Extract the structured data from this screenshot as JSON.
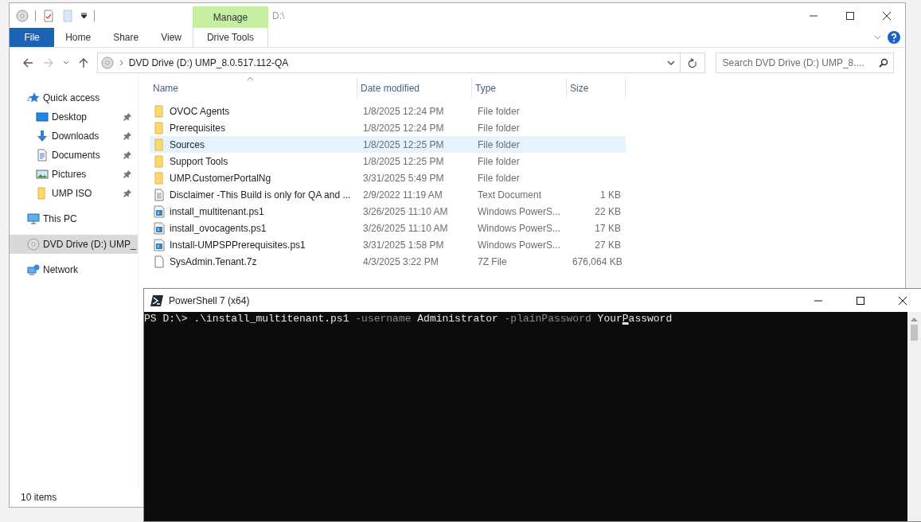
{
  "explorer": {
    "title": "D:\\",
    "contextual_header": "Manage",
    "ribbon_tabs": [
      {
        "label": "File",
        "kind": "file"
      },
      {
        "label": "Home",
        "kind": "tab"
      },
      {
        "label": "Share",
        "kind": "tab"
      },
      {
        "label": "View",
        "kind": "tab"
      },
      {
        "label": "Drive Tools",
        "kind": "contextual"
      }
    ],
    "address": {
      "path": "DVD Drive (D:) UMP_8.0.517.112-QA"
    },
    "search": {
      "placeholder": "Search DVD Drive (D:) UMP_8...."
    },
    "nav": [
      {
        "label": "Quick access",
        "kind": "star",
        "pinned": false,
        "selected": false,
        "children": [
          {
            "label": "Desktop",
            "kind": "desktop",
            "pinned": true,
            "selected": false
          },
          {
            "label": "Downloads",
            "kind": "download",
            "pinned": true,
            "selected": false
          },
          {
            "label": "Documents",
            "kind": "documents",
            "pinned": true,
            "selected": false
          },
          {
            "label": "Pictures",
            "kind": "pictures",
            "pinned": true,
            "selected": false
          },
          {
            "label": "UMP ISO",
            "kind": "folder",
            "pinned": true,
            "selected": false
          }
        ]
      },
      {
        "label": "This PC",
        "kind": "pc",
        "pinned": false,
        "selected": false
      },
      {
        "label": "DVD Drive (D:) UMP_",
        "kind": "dvd",
        "pinned": false,
        "selected": true
      },
      {
        "label": "Network",
        "kind": "network",
        "pinned": false,
        "selected": false
      }
    ],
    "columns": [
      {
        "label": "Name",
        "sorted": true
      },
      {
        "label": "Date modified",
        "sorted": false
      },
      {
        "label": "Type",
        "sorted": false
      },
      {
        "label": "Size",
        "sorted": false
      }
    ],
    "files": [
      {
        "name": "OVOC Agents",
        "date": "1/8/2025 12:24 PM",
        "type": "File folder",
        "kind": "folder",
        "selected": false
      },
      {
        "name": "Prerequisites",
        "date": "1/8/2025 12:24 PM",
        "type": "File folder",
        "kind": "folder",
        "selected": false
      },
      {
        "name": "Sources",
        "date": "1/8/2025 12:25 PM",
        "type": "File folder",
        "kind": "folder",
        "selected": true
      },
      {
        "name": "Support Tools",
        "date": "1/8/2025 12:25 PM",
        "type": "File folder",
        "kind": "folder",
        "selected": false
      },
      {
        "name": "UMP.CustomerPortalNg",
        "date": "3/31/2025 5:49 PM",
        "type": "File folder",
        "kind": "folder",
        "selected": false
      },
      {
        "name": "Disclaimer -This Build is only for QA and ...",
        "date": "2/9/2022 11:19 AM",
        "type": "Text Document",
        "size": "1 KB",
        "kind": "text",
        "selected": false
      },
      {
        "name": "install_multitenant.ps1",
        "date": "3/26/2025 11:10 AM",
        "type": "Windows PowerS...",
        "size": "22 KB",
        "kind": "script",
        "selected": false
      },
      {
        "name": "install_ovocagents.ps1",
        "date": "3/26/2025 11:10 AM",
        "type": "Windows PowerS...",
        "size": "17 KB",
        "kind": "script",
        "selected": false
      },
      {
        "name": "Install-UMPSPPrerequisites.ps1",
        "date": "3/31/2025 1:58 PM",
        "type": "Windows PowerS...",
        "size": "27 KB",
        "kind": "script",
        "selected": false
      },
      {
        "name": "SysAdmin.Tenant.7z",
        "date": "4/3/2025 3:22 PM",
        "type": "7Z File",
        "size": "676,064 KB",
        "kind": "file",
        "selected": false
      }
    ],
    "status_bar": "10 items"
  },
  "powershell": {
    "title": "PowerShell 7 (x64)",
    "tokens": [
      {
        "text": "PS D:\\>",
        "kind": "prompt",
        "glue": true,
        "cursor": false
      },
      {
        "text": ".\\install_multitenant.ps1",
        "kind": "command",
        "glue": false,
        "cursor": false
      },
      {
        "text": "-username",
        "kind": "parameter",
        "glue": false,
        "cursor": false
      },
      {
        "text": "Administrator",
        "kind": "value",
        "glue": false,
        "cursor": false
      },
      {
        "text": "-plainPassword",
        "kind": "parameter",
        "glue": false,
        "cursor": false
      },
      {
        "text": "Your",
        "kind": "value",
        "glue": false,
        "cursor": false
      },
      {
        "text": "P",
        "kind": "value",
        "glue": true,
        "cursor": true
      },
      {
        "text": "assword",
        "kind": "value",
        "glue": true,
        "cursor": false
      }
    ]
  }
}
